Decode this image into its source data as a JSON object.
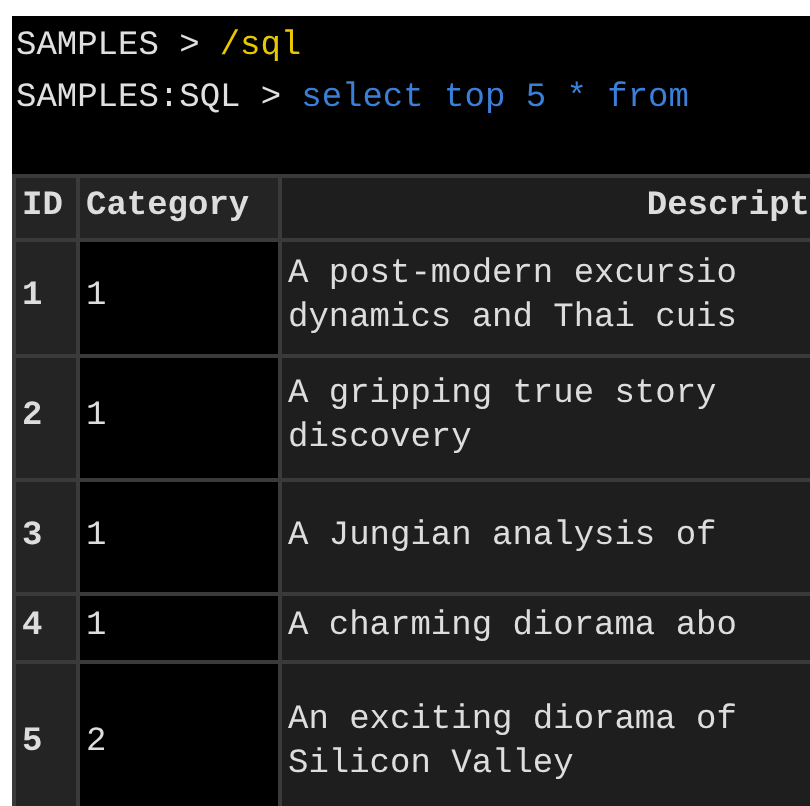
{
  "terminal": {
    "lines": [
      {
        "prompt": "SAMPLES >",
        "command": "/sql",
        "kind": "shell"
      },
      {
        "prompt": "SAMPLES:SQL >",
        "command": "select top 5 * from",
        "kind": "sql"
      }
    ]
  },
  "table": {
    "columns": [
      "ID",
      "Category",
      "Descript"
    ],
    "rows": [
      {
        "id": "1",
        "category": "1",
        "description": [
          "A post-modern excursio",
          "dynamics and Thai cuis"
        ]
      },
      {
        "id": "2",
        "category": "1",
        "description": [
          "A gripping true story",
          "discovery"
        ]
      },
      {
        "id": "3",
        "category": "1",
        "description": [
          "A Jungian analysis of"
        ]
      },
      {
        "id": "4",
        "category": "1",
        "description": [
          "A charming diorama abo"
        ]
      },
      {
        "id": "5",
        "category": "2",
        "description": [
          "An exciting diorama of",
          "Silicon Valley"
        ]
      }
    ]
  }
}
